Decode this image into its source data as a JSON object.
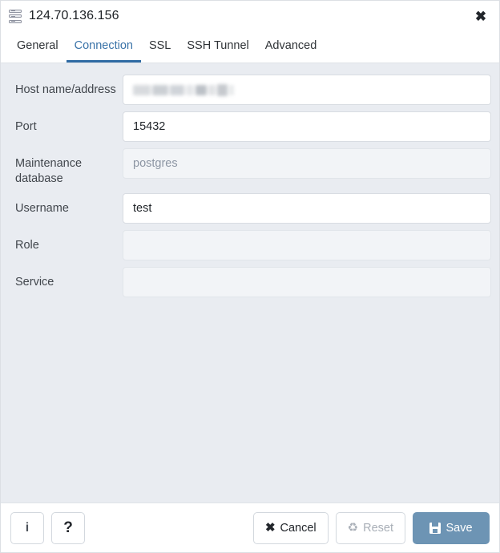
{
  "window": {
    "title": "124.70.136.156",
    "icon": "server-stack-icon",
    "close_label": "✖"
  },
  "tabs": [
    {
      "label": "General",
      "active": false
    },
    {
      "label": "Connection",
      "active": true
    },
    {
      "label": "SSL",
      "active": false
    },
    {
      "label": "SSH Tunnel",
      "active": false
    },
    {
      "label": "Advanced",
      "active": false
    }
  ],
  "form": {
    "fields": [
      {
        "label": "Host name/address",
        "value": "",
        "placeholder": "",
        "state": "redacted",
        "name": "host-name-address"
      },
      {
        "label": "Port",
        "value": "15432",
        "placeholder": "",
        "state": "filled",
        "name": "port"
      },
      {
        "label": "Maintenance database",
        "value": "",
        "placeholder": "postgres",
        "state": "placeholder",
        "name": "maintenance-database"
      },
      {
        "label": "Username",
        "value": "test",
        "placeholder": "",
        "state": "filled",
        "name": "username"
      },
      {
        "label": "Role",
        "value": "",
        "placeholder": "",
        "state": "empty",
        "name": "role"
      },
      {
        "label": "Service",
        "value": "",
        "placeholder": "",
        "state": "empty",
        "name": "service"
      }
    ]
  },
  "footer": {
    "info_label": "i",
    "help_label": "?",
    "cancel_label": "Cancel",
    "cancel_icon": "✖",
    "reset_label": "Reset",
    "reset_icon": "♻",
    "save_label": "Save"
  },
  "colors": {
    "accent": "#2f6ba3",
    "save_bg": "#6d94b4",
    "body_bg": "#e9ecf1",
    "field_empty_bg": "#f2f4f7",
    "disabled_text": "#a9afb7"
  }
}
